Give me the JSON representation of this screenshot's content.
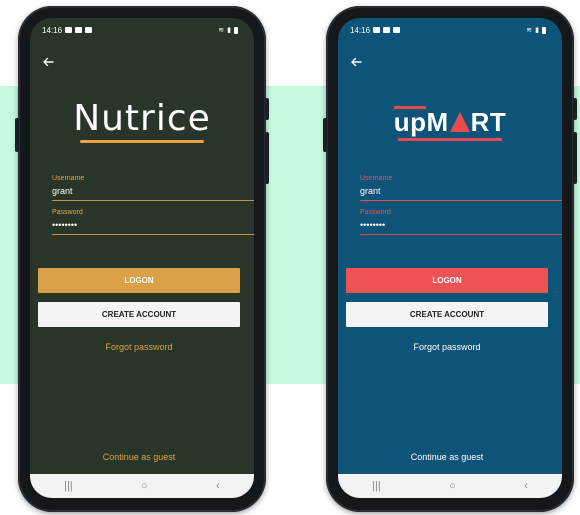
{
  "status": {
    "time": "14:16"
  },
  "phones": [
    {
      "brand": "Nutrice",
      "username_label": "Username",
      "username_value": "grant",
      "password_label": "Password",
      "password_value": "••••••••",
      "logon_label": "LOGON",
      "create_label": "CREATE ACCOUNT",
      "forgot_label": "Forgot password",
      "guest_label": "Continue as guest",
      "colors": {
        "background": "#283528",
        "accent": "#e8a447"
      }
    },
    {
      "brand_parts": {
        "up": "up",
        "m": "M",
        "rt": "RT"
      },
      "username_label": "Username",
      "username_value": "grant",
      "password_label": "Password",
      "password_value": "••••••••",
      "logon_label": "LOGON",
      "create_label": "CREATE ACCOUNT",
      "forgot_label": "Forgot password",
      "guest_label": "Continue as guest",
      "colors": {
        "background": "#0e5378",
        "accent": "#ee5252"
      }
    }
  ],
  "navbar": {
    "recent_icon": "|||",
    "home_icon": "○",
    "back_icon": "‹"
  }
}
